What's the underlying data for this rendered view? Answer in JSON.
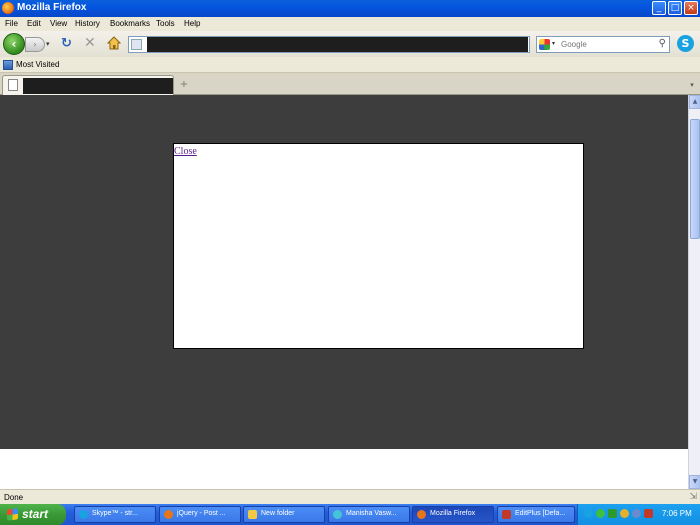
{
  "window": {
    "title": "Mozilla Firefox",
    "minimize": "_",
    "maximize": "□",
    "close": "×"
  },
  "menu": [
    "File",
    "Edit",
    "View",
    "History",
    "Bookmarks",
    "Tools",
    "Help"
  ],
  "nav": {
    "back": "‹",
    "forward": "›",
    "dropdown": "▾",
    "reload": "↻",
    "stop": "✕",
    "search_placeholder": "Google",
    "search_icon": "⚲",
    "skype": "S"
  },
  "bookmarks": {
    "most_visited": "Most Visited"
  },
  "tabs": {
    "new_tab": "+",
    "list": "▾"
  },
  "content": {
    "close_link": "Close"
  },
  "scrollbar": {
    "up": "▲",
    "down": "▼"
  },
  "status": {
    "text": "Done",
    "grip": "⇲"
  },
  "taskbar": {
    "start": "start",
    "items": [
      {
        "label": "Skype™ - str...",
        "color": "#18a2e0"
      },
      {
        "label": "jQuery - Post ...",
        "color": "#e8751a"
      },
      {
        "label": "New folder",
        "color": "#f4c842"
      },
      {
        "label": "Manisha Vasw...",
        "color": "#45c4d8"
      },
      {
        "label": "Mozilla Firefox",
        "color": "#e8751a"
      },
      {
        "label": "EditPlus [Defa...",
        "color": "#c0392b"
      }
    ],
    "clock": "7:06 PM"
  },
  "colors": {
    "overlay": "#3d3d3d",
    "link_visited": "#551a8b",
    "taskbar": "#245edb",
    "start_green": "#3a9a36"
  }
}
